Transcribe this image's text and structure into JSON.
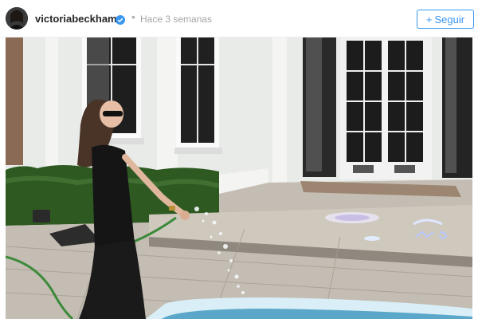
{
  "post": {
    "username": "victoriabeckham",
    "verified": true,
    "separator": "•",
    "time_ago": "Hace 3 semanas",
    "follow_plus": "+",
    "follow_label": "Seguir"
  },
  "photo": {
    "icon": "photo-garden-pool",
    "accent_color": "#3897f0"
  }
}
